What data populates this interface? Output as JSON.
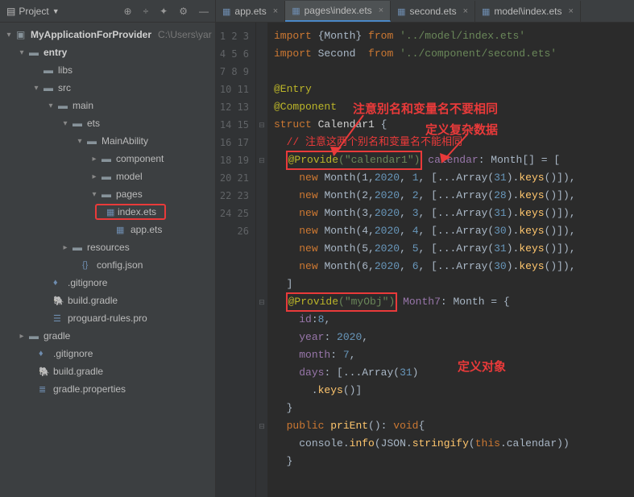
{
  "header": {
    "title": "Project"
  },
  "tree": {
    "project": "MyApplicationForProvider",
    "projectPath": "C:\\Users\\yar",
    "entry": "entry",
    "libs": "libs",
    "src": "src",
    "main": "main",
    "ets": "ets",
    "mainAbility": "MainAbility",
    "component": "component",
    "model": "model",
    "pages": "pages",
    "indexEts": "index.ets",
    "appEts": "app.ets",
    "resources": "resources",
    "configJson": "config.json",
    "gitignore1": ".gitignore",
    "buildGradle1": "build.gradle",
    "proguard": "proguard-rules.pro",
    "gradle": "gradle",
    "gitignore2": ".gitignore",
    "buildGradle2": "build.gradle",
    "gradleProps": "gradle.properties"
  },
  "tabs": {
    "t1": "app.ets",
    "t2": "pages\\index.ets",
    "t3": "second.ets",
    "t4": "model\\index.ets"
  },
  "code": {
    "l1a": "import",
    "l1b": "{Month}",
    "l1c": "from",
    "l1d": "'../model/index.ets'",
    "l2a": "import",
    "l2b": "Second",
    "l2c": "from",
    "l2d": "'../component/second.ets'",
    "l4": "@Entry",
    "l5": "@Component",
    "l6a": "struct",
    "l6b": "Calendar1",
    "l6c": "{",
    "l7": "// 注意这两个别名和变量名不能相同",
    "l8a": "@Provide",
    "l8b": "(\"calendar1\")",
    "l8c": "calendar",
    "l8d": "Month",
    "l8e": "[] = [",
    "l9a": "new",
    "l9b": "Month",
    "l9c": "(1,",
    "l9d": "2020",
    "l9e": ",",
    "l9f": "1",
    "l9g": ", [...Array(",
    "l9h": "31",
    "l9i": ").",
    "l9j": "keys",
    "l9k": "()]),",
    "l10d": "2020",
    "l10f": "2",
    "l10h": "28",
    "l11d": "2020",
    "l11f": "3",
    "l11h": "31",
    "l12d": "2020",
    "l12f": "4",
    "l12h": "30",
    "l13d": "2020",
    "l13f": "5",
    "l13h": "31",
    "l14d": "2020",
    "l14f": "6",
    "l14h": "30",
    "l16a": "@Provide",
    "l16b": "(\"myObj\")",
    "l16c": "Month7",
    "l16d": "Month",
    "l16e": " = {",
    "l17a": "id",
    "l17b": ":",
    "l17c": "8",
    "l18a": "year",
    "l18b": ":",
    "l18c": "2020",
    "l19a": "month",
    "l19b": ":",
    "l19c": "7",
    "l20a": "days",
    "l20b": ": [...Array(",
    "l20c": "31",
    "l20d": ")",
    "l21a": ".",
    "l21b": "keys",
    "l21c": "()]",
    "l23a": "public",
    "l23b": "priEnt",
    "l23c": "():",
    "l23d": "void",
    "l23e": "{",
    "l24a": "console",
    "l24b": ".",
    "l24c": "info",
    "l24d": "(",
    "l24e": "JSON",
    "l24f": ".",
    "l24g": "stringify",
    "l24h": "(",
    "l24i": "this",
    "l24j": ".calendar))"
  },
  "annotations": {
    "a1": "注意别名和变量名不要相同",
    "a2": "定义复杂数据",
    "a3": "定义对象"
  }
}
